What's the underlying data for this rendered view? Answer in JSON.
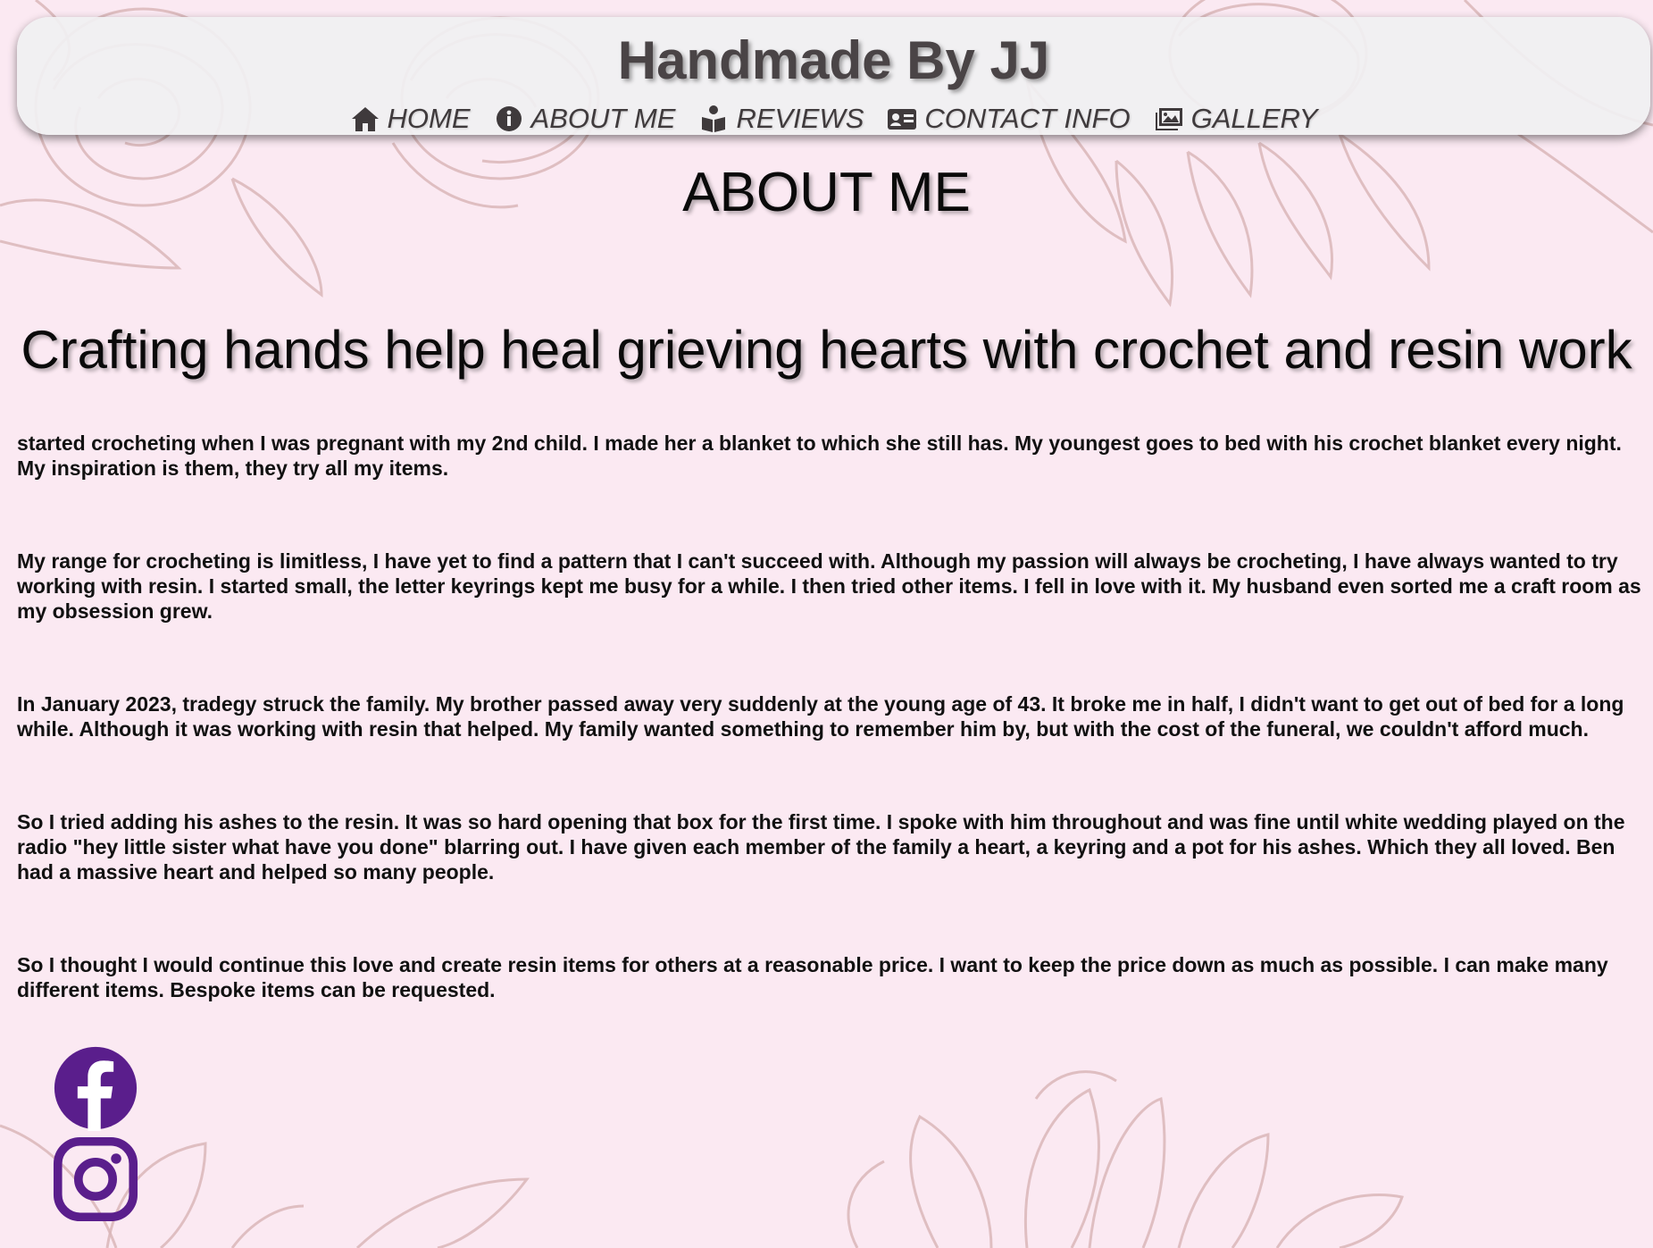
{
  "site": {
    "title": "Handmade By JJ"
  },
  "nav": {
    "items": [
      {
        "label": "HOME",
        "icon": "home-icon"
      },
      {
        "label": "ABOUT ME",
        "icon": "info-icon"
      },
      {
        "label": "REVIEWS",
        "icon": "reader-icon"
      },
      {
        "label": "CONTACT INFO",
        "icon": "id-card-icon"
      },
      {
        "label": "GALLERY",
        "icon": "images-icon"
      }
    ]
  },
  "main": {
    "heading": "ABOUT ME",
    "tagline": "Crafting hands help heal grieving hearts with crochet and resin work",
    "paragraphs": [
      "started crocheting when I was pregnant with my 2nd child. I made her a blanket to which she still has. My youngest goes to bed with his crochet blanket every night. My inspiration is them, they try all my items.",
      "My range for crocheting is limitless, I have yet to find a pattern that I can't succeed with. Although my passion will always be crocheting, I have always wanted to try working with resin. I started small, the letter keyrings kept me busy for a while. I then tried other items. I fell in love with it. My husband even sorted me a craft room as my obsession grew.",
      "In January 2023, tradegy struck the family. My brother passed away very suddenly at the young age of 43. It broke me in half, I didn't want to get out of bed for a long while. Although it was working with resin that helped. My family wanted something to remember him by, but with the cost of the funeral, we couldn't afford much.",
      "So I tried adding his ashes to the resin. It was so hard opening that box for the first time. I spoke with him throughout and was fine until white wedding played on the radio \"hey little sister what have you done\" blarring out. I have given each member of the family a heart, a keyring and a pot for his ashes. Which they all loved. Ben had a massive heart and helped so many people.",
      "So I thought I would continue this love and create resin items for others at a reasonable price. I want to keep the price down as much as possible. I can make many different items. Bespoke items can be requested."
    ]
  },
  "social": {
    "facebook_icon": "facebook-icon",
    "instagram_icon": "instagram-icon",
    "color": "#5a1e8c"
  },
  "colors": {
    "background": "#fbe9f2",
    "floral_line": "#d9b6b8",
    "header_bg": "#f0f0f2"
  }
}
